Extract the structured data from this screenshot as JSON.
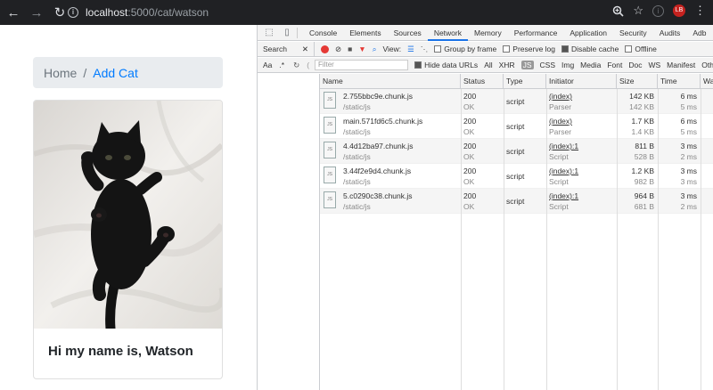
{
  "browser": {
    "back": "←",
    "forward": "→",
    "reload": "↻",
    "url_host": "localhost",
    "url_path": ":5000/cat/watson",
    "ext_label": "LB"
  },
  "page": {
    "breadcrumb": {
      "home": "Home",
      "separator": "/",
      "current": "Add Cat"
    },
    "card_title": "Hi my name is, Watson"
  },
  "devtools": {
    "tabs": [
      "Console",
      "Elements",
      "Sources",
      "Network",
      "Memory",
      "Performance",
      "Application",
      "Security",
      "Audits",
      "Adb"
    ],
    "active_tab": "Network",
    "toolbar": {
      "search_label": "Search",
      "view_label": "View:",
      "group_by_frame": "Group by frame",
      "preserve_log": "Preserve log",
      "disable_cache": "Disable cache",
      "offline": "Offline"
    },
    "filter": {
      "aa": "Aa",
      "regex": ".*",
      "placeholder": "Filter",
      "hide_data_urls": "Hide data URLs",
      "types": [
        "All",
        "XHR",
        "JS",
        "CSS",
        "Img",
        "Media",
        "Font",
        "Doc",
        "WS",
        "Manifest",
        "Oth"
      ],
      "selected_type": "JS"
    },
    "columns": [
      "Name",
      "Status",
      "Type",
      "Initiator",
      "Size",
      "Time",
      "Wa"
    ],
    "rows": [
      {
        "name": "2.755bbc9e.chunk.js",
        "path": "/static/js",
        "status": "200",
        "status_text": "OK",
        "type": "script",
        "initiator": "(index)",
        "initiator_sub": "Parser",
        "size": "142 KB",
        "size_sub": "142 KB",
        "time": "6 ms",
        "time_sub": "5 ms"
      },
      {
        "name": "main.571fd6c5.chunk.js",
        "path": "/static/js",
        "status": "200",
        "status_text": "OK",
        "type": "script",
        "initiator": "(index)",
        "initiator_sub": "Parser",
        "size": "1.7 KB",
        "size_sub": "1.4 KB",
        "time": "6 ms",
        "time_sub": "5 ms"
      },
      {
        "name": "4.4d12ba97.chunk.js",
        "path": "/static/js",
        "status": "200",
        "status_text": "OK",
        "type": "script",
        "initiator": "(index):1",
        "initiator_sub": "Script",
        "size": "811 B",
        "size_sub": "528 B",
        "time": "3 ms",
        "time_sub": "2 ms"
      },
      {
        "name": "3.44f2e9d4.chunk.js",
        "path": "/static/js",
        "status": "200",
        "status_text": "OK",
        "type": "script",
        "initiator": "(index):1",
        "initiator_sub": "Script",
        "size": "1.2 KB",
        "size_sub": "982 B",
        "time": "3 ms",
        "time_sub": "3 ms"
      },
      {
        "name": "5.c0290c38.chunk.js",
        "path": "/static/js",
        "status": "200",
        "status_text": "OK",
        "type": "script",
        "initiator": "(index):1",
        "initiator_sub": "Script",
        "size": "964 B",
        "size_sub": "681 B",
        "time": "3 ms",
        "time_sub": "2 ms"
      }
    ]
  },
  "colors": {
    "accent": "#1a73e8",
    "link": "#007bff",
    "breadcrumb_bg": "#e9ecef",
    "chrome_bar": "#202124"
  }
}
